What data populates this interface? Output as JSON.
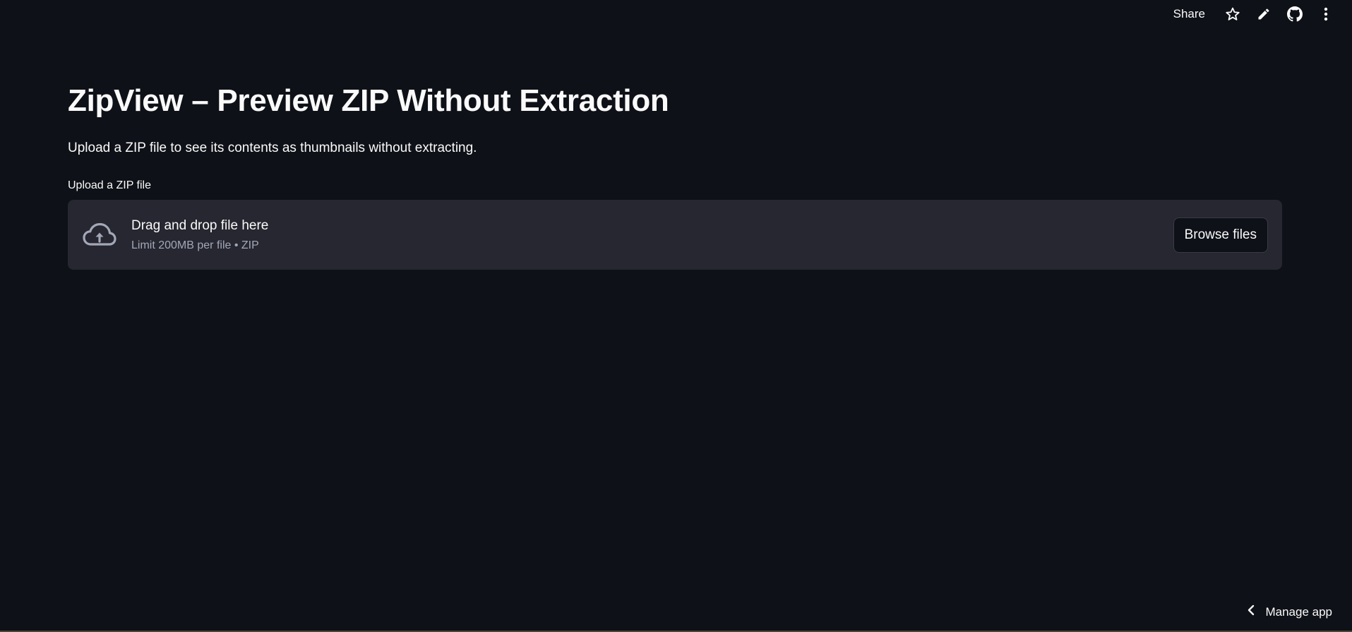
{
  "toolbar": {
    "share_label": "Share",
    "icons": [
      "star-icon",
      "edit-pencil-icon",
      "github-icon",
      "more-vertical-icon"
    ]
  },
  "main": {
    "title": "ZipView – Preview ZIP Without Extraction",
    "subtitle": "Upload a ZIP file to see its contents as thumbnails without extracting."
  },
  "uploader": {
    "label": "Upload a ZIP file",
    "drop_title": "Drag and drop file here",
    "limit_text": "Limit 200MB per file • ZIP",
    "browse_label": "Browse files",
    "icon": "cloud-upload-icon"
  },
  "footer": {
    "manage_label": "Manage app",
    "icon": "chevron-left-icon"
  },
  "colors": {
    "background": "#0e1117",
    "dropzone": "#262730",
    "text": "#fafafa",
    "muted_text": "#a3a8b8"
  }
}
